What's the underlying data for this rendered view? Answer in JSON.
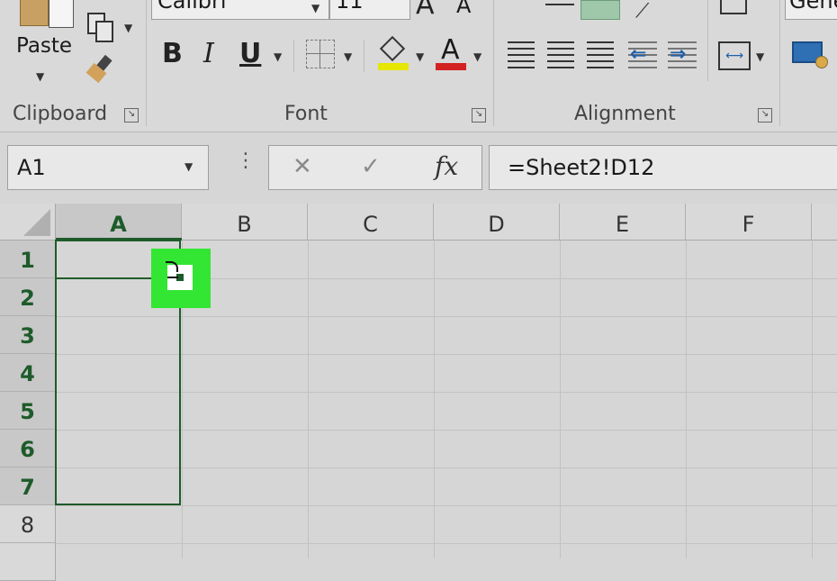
{
  "ribbon": {
    "clipboard": {
      "paste_label": "Paste",
      "group_label": "Clipboard"
    },
    "font": {
      "name": "Calibri",
      "size": "11",
      "group_label": "Font",
      "bold_label": "B",
      "italic_label": "I",
      "underline_label": "U",
      "color_glyph": "A",
      "grow_glyph": "A",
      "shrink_glyph": "A"
    },
    "alignment": {
      "group_label": "Alignment"
    },
    "number": {
      "format": "Gene"
    }
  },
  "formula_bar": {
    "name_box": "A1",
    "cancel_glyph": "✕",
    "enter_glyph": "✓",
    "fx_label": "fx",
    "formula": "=Sheet2!D12"
  },
  "grid": {
    "columns": [
      "A",
      "B",
      "C",
      "D",
      "E",
      "F"
    ],
    "rows": [
      "1",
      "2",
      "3",
      "4",
      "5",
      "6",
      "7",
      "8"
    ],
    "selected_range": "A1:A7",
    "fill_handle_color": "#33e633"
  },
  "colors": {
    "selection": "#1e5b2a",
    "highlight_fill": "#e6e600",
    "font_color_bar": "#d32222",
    "ribbon_bg": "#d9d9d9"
  }
}
